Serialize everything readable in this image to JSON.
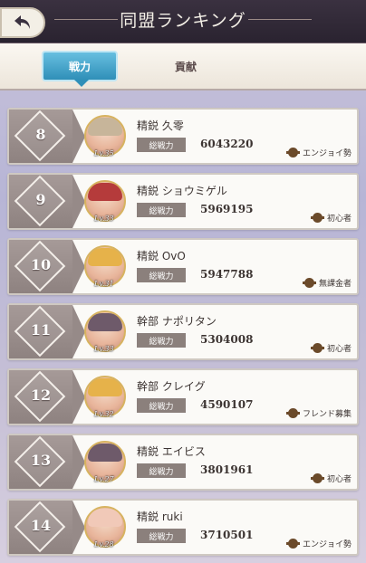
{
  "header": {
    "title": "同盟ランキング",
    "back_icon": "back-arrow-icon"
  },
  "tabs": [
    {
      "label": "戦力",
      "active": true
    },
    {
      "label": "貢献",
      "active": false
    }
  ],
  "rows": [
    {
      "rank": "8",
      "role": "精鋭",
      "name": "久零",
      "level": "Lv.35",
      "cp_label": "総戦力",
      "cp": "6043220",
      "tag": "エンジョイ勢",
      "hair": "#c7b59a"
    },
    {
      "rank": "9",
      "role": "精鋭",
      "name": "ショウミゲル",
      "level": "Lv.33",
      "cp_label": "総戦力",
      "cp": "5969195",
      "tag": "初心者",
      "hair": "#b53b3b"
    },
    {
      "rank": "10",
      "role": "精鋭",
      "name": "OvO",
      "level": "Lv.31",
      "cp_label": "総戦力",
      "cp": "5947788",
      "tag": "無課金者",
      "hair": "#e6b24a"
    },
    {
      "rank": "11",
      "role": "幹部",
      "name": "ナポリタン",
      "level": "Lv.33",
      "cp_label": "総戦力",
      "cp": "5304008",
      "tag": "初心者",
      "hair": "#6e5a6a"
    },
    {
      "rank": "12",
      "role": "幹部",
      "name": "クレイグ",
      "level": "Lv.32",
      "cp_label": "総戦力",
      "cp": "4590107",
      "tag": "フレンド募集",
      "hair": "#e6b24a"
    },
    {
      "rank": "13",
      "role": "精鋭",
      "name": "エイビス",
      "level": "Lv.27",
      "cp_label": "総戦力",
      "cp": "3801961",
      "tag": "初心者",
      "hair": "#6e5a6a"
    },
    {
      "rank": "14",
      "role": "精鋭",
      "name": "ruki",
      "level": "Lv.28",
      "cp_label": "総戦力",
      "cp": "3710501",
      "tag": "エンジョイ勢",
      "hair": "#f1c9b8"
    }
  ]
}
